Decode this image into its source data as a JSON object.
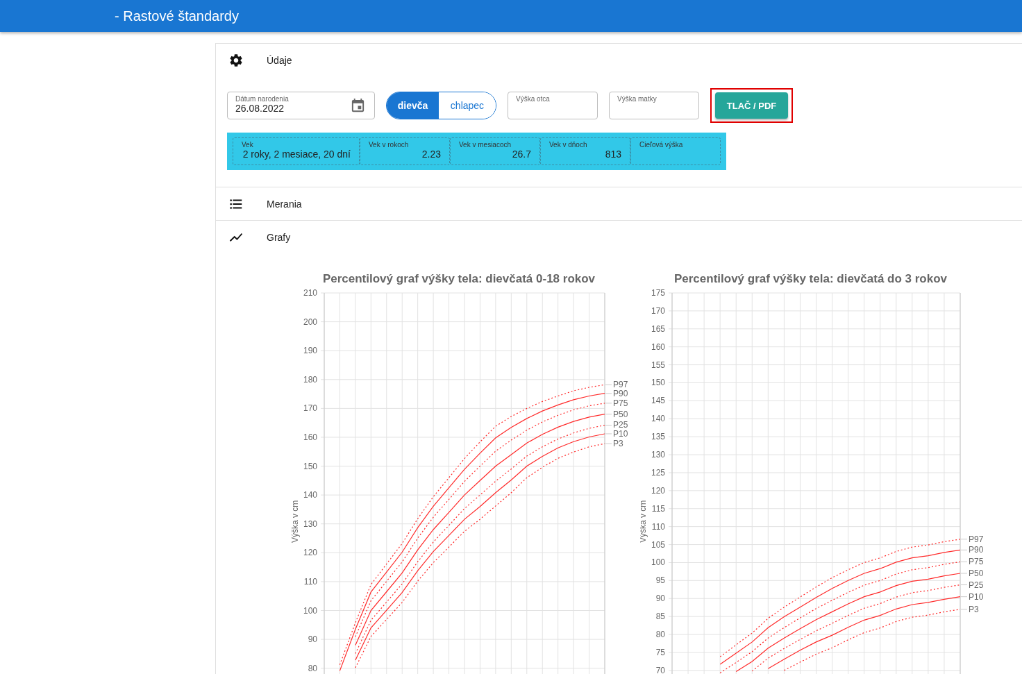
{
  "header": {
    "title": "- Rastové štandardy"
  },
  "udaje": {
    "title": "Údaje",
    "birth_date": {
      "label": "Dátum narodenia",
      "value": "26.08.2022"
    },
    "sex_toggle": [
      {
        "label": "dievča",
        "selected": true
      },
      {
        "label": "chlapec",
        "selected": false
      }
    ],
    "father_height": {
      "label": "Výška otca"
    },
    "mother_height": {
      "label": "Výška matky"
    },
    "print_button": {
      "label": "TLAČ / PDF",
      "highlighted": true
    },
    "age_info": [
      {
        "label": "Vek",
        "value": "2 roky, 2 mesiace, 20 dní"
      },
      {
        "label": "Vek v rokoch",
        "value": "2.23"
      },
      {
        "label": "Vek v mesiacoch",
        "value": "26.7"
      },
      {
        "label": "Vek v dňoch",
        "value": "813"
      },
      {
        "label": "Cieľová výška"
      }
    ]
  },
  "merania": {
    "title": "Merania"
  },
  "grafy": {
    "title": "Grafy",
    "charts": [
      {
        "chart_data": {
          "type": "line",
          "title": "Percentilový graf výšky tela: dievčatá 0-18 rokov",
          "ylabel": "Výška v cm",
          "grid": true,
          "ylim": [
            78,
            210
          ],
          "yticks": [
            80,
            90,
            100,
            110,
            120,
            130,
            140,
            150,
            160,
            170,
            180,
            190,
            200,
            210
          ],
          "series": [
            {
              "name": "P97",
              "color": "#ff2a2a",
              "line_style": "dotted",
              "values": [
                null,
                81.2,
                95.8,
                109,
                116.1,
                123.2,
                131.8,
                139.4,
                146,
                152.6,
                158.4,
                163.8,
                167.2,
                170,
                172.4,
                174.3,
                176.1,
                177.3,
                178.2
              ]
            },
            {
              "name": "P90",
              "color": "#ff2a2a",
              "line_style": "solid",
              "values": [
                null,
                79.1,
                93.5,
                106.4,
                113.3,
                120.2,
                128.7,
                136.1,
                142.5,
                148.9,
                154.5,
                159.8,
                163.4,
                166.5,
                169.1,
                171.2,
                173,
                174.3,
                175.2
              ]
            },
            {
              "name": "P75",
              "color": "#ff2a2a",
              "line_style": "dotted",
              "values": [
                null,
                null,
                90.9,
                103.4,
                110.1,
                116.8,
                125.1,
                132.3,
                138.5,
                144.7,
                150,
                155.2,
                159,
                162.5,
                165.3,
                167.6,
                169.5,
                170.9,
                171.8
              ]
            },
            {
              "name": "P50",
              "color": "#ff2a2a",
              "line_style": "solid",
              "values": [
                null,
                null,
                88,
                100,
                106.5,
                113,
                121,
                128,
                134,
                140,
                145,
                150,
                154,
                158,
                161,
                163.5,
                165.5,
                167,
                168
              ]
            },
            {
              "name": "P25",
              "color": "#ff2a2a",
              "line_style": "dotted",
              "values": [
                null,
                null,
                85.1,
                96.6,
                102.9,
                109.2,
                116.9,
                123.7,
                129.5,
                135.3,
                140,
                144.8,
                149,
                153.5,
                156.7,
                159.4,
                161.5,
                163.1,
                164.2
              ]
            },
            {
              "name": "P10",
              "color": "#ff2a2a",
              "line_style": "solid",
              "values": [
                null,
                null,
                82.8,
                94,
                100.1,
                106.2,
                113.8,
                120.4,
                126,
                131.6,
                136,
                140.8,
                145.2,
                150,
                153.4,
                156.3,
                158.5,
                160.1,
                161.2
              ]
            },
            {
              "name": "P3",
              "color": "#ff2a2a",
              "line_style": "dotted",
              "values": [
                null,
                null,
                80.2,
                91,
                96.9,
                102.8,
                110.2,
                116.6,
                122,
                127.4,
                131.6,
                136.2,
                140.8,
                146,
                149.6,
                152.7,
                154.9,
                156.7,
                157.8
              ]
            }
          ]
        }
      },
      {
        "chart_data": {
          "type": "line",
          "title": "Percentilový graf výšky tela: dievčatá do 3 rokov",
          "ylabel": "Výška v cm",
          "grid": true,
          "ylim": [
            69,
            175
          ],
          "yticks": [
            70,
            75,
            80,
            85,
            90,
            95,
            100,
            105,
            110,
            115,
            120,
            125,
            130,
            135,
            140,
            145,
            150,
            155,
            160,
            165,
            170,
            175
          ],
          "series": [
            {
              "name": "P97",
              "color": "#ff2a2a",
              "line_style": "dotted",
              "values": [
                null,
                null,
                null,
                73.8,
                77.1,
                80.4,
                84.5,
                87.6,
                90.4,
                93.2,
                95.8,
                98,
                100,
                101.3,
                103.1,
                104.3,
                104.9,
                105.8,
                106.5
              ]
            },
            {
              "name": "P90",
              "color": "#ff2a2a",
              "line_style": "solid",
              "values": [
                null,
                null,
                null,
                71.7,
                74.8,
                77.9,
                81.9,
                84.9,
                87.6,
                90.3,
                92.8,
                95,
                97,
                98.3,
                100.1,
                101.3,
                101.9,
                102.8,
                103.5
              ]
            },
            {
              "name": "P75",
              "color": "#ff2a2a",
              "line_style": "dotted",
              "values": [
                null,
                null,
                null,
                69.3,
                72.2,
                75.2,
                79,
                81.9,
                84.6,
                87.2,
                89.5,
                91.7,
                93.7,
                95,
                96.8,
                98,
                98.6,
                99.5,
                100.2
              ]
            },
            {
              "name": "P50",
              "color": "#ff2a2a",
              "line_style": "solid",
              "values": [
                null,
                null,
                null,
                null,
                69.7,
                72.5,
                76.2,
                79,
                81.6,
                84.1,
                86.3,
                88.5,
                90.5,
                91.8,
                93.6,
                94.8,
                95.4,
                96.3,
                97
              ]
            },
            {
              "name": "P25",
              "color": "#ff2a2a",
              "line_style": "dotted",
              "values": [
                null,
                null,
                null,
                null,
                null,
                69.8,
                73.4,
                76.1,
                78.6,
                81,
                83.1,
                85.3,
                87.3,
                88.6,
                90.4,
                91.6,
                92.2,
                93.1,
                93.8
              ]
            },
            {
              "name": "P10",
              "color": "#ff2a2a",
              "line_style": "solid",
              "values": [
                null,
                null,
                null,
                null,
                null,
                null,
                70.5,
                73.1,
                75.6,
                77.9,
                79.8,
                82,
                84,
                85.3,
                87.1,
                88.3,
                88.9,
                89.8,
                90.5
              ]
            },
            {
              "name": "P3",
              "color": "#ff2a2a",
              "line_style": "dotted",
              "values": [
                null,
                null,
                null,
                null,
                null,
                null,
                null,
                70,
                72.3,
                74.5,
                76.3,
                78.5,
                80.5,
                81.8,
                83.6,
                84.8,
                85.4,
                86.3,
                87
              ]
            }
          ]
        }
      }
    ]
  }
}
